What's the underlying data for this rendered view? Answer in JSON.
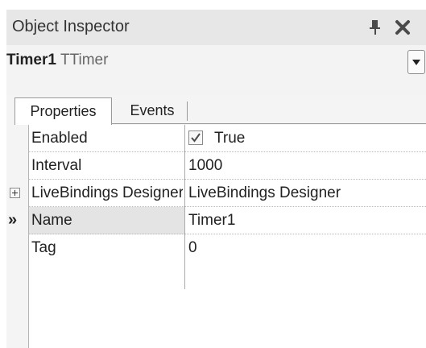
{
  "window": {
    "title": "Object Inspector"
  },
  "object": {
    "name": "Timer1",
    "type": "TTimer"
  },
  "tabs": [
    {
      "label": "Properties",
      "active": true
    },
    {
      "label": "Events",
      "active": false
    }
  ],
  "properties": [
    {
      "name": "Enabled",
      "value": "True",
      "checked": true
    },
    {
      "name": "Interval",
      "value": "1000"
    },
    {
      "name": "LiveBindings Designer",
      "value": "LiveBindings Designer",
      "expandable": true
    },
    {
      "name": "Name",
      "value": "Timer1",
      "selected": true,
      "marker": "»"
    },
    {
      "name": "Tag",
      "value": "0"
    }
  ],
  "icons": {
    "pin": "pin-icon",
    "close": "close-icon",
    "dropdown": "chevron-down-icon",
    "expand": "plus-expand-icon",
    "checkbox": "checkmark-icon"
  }
}
